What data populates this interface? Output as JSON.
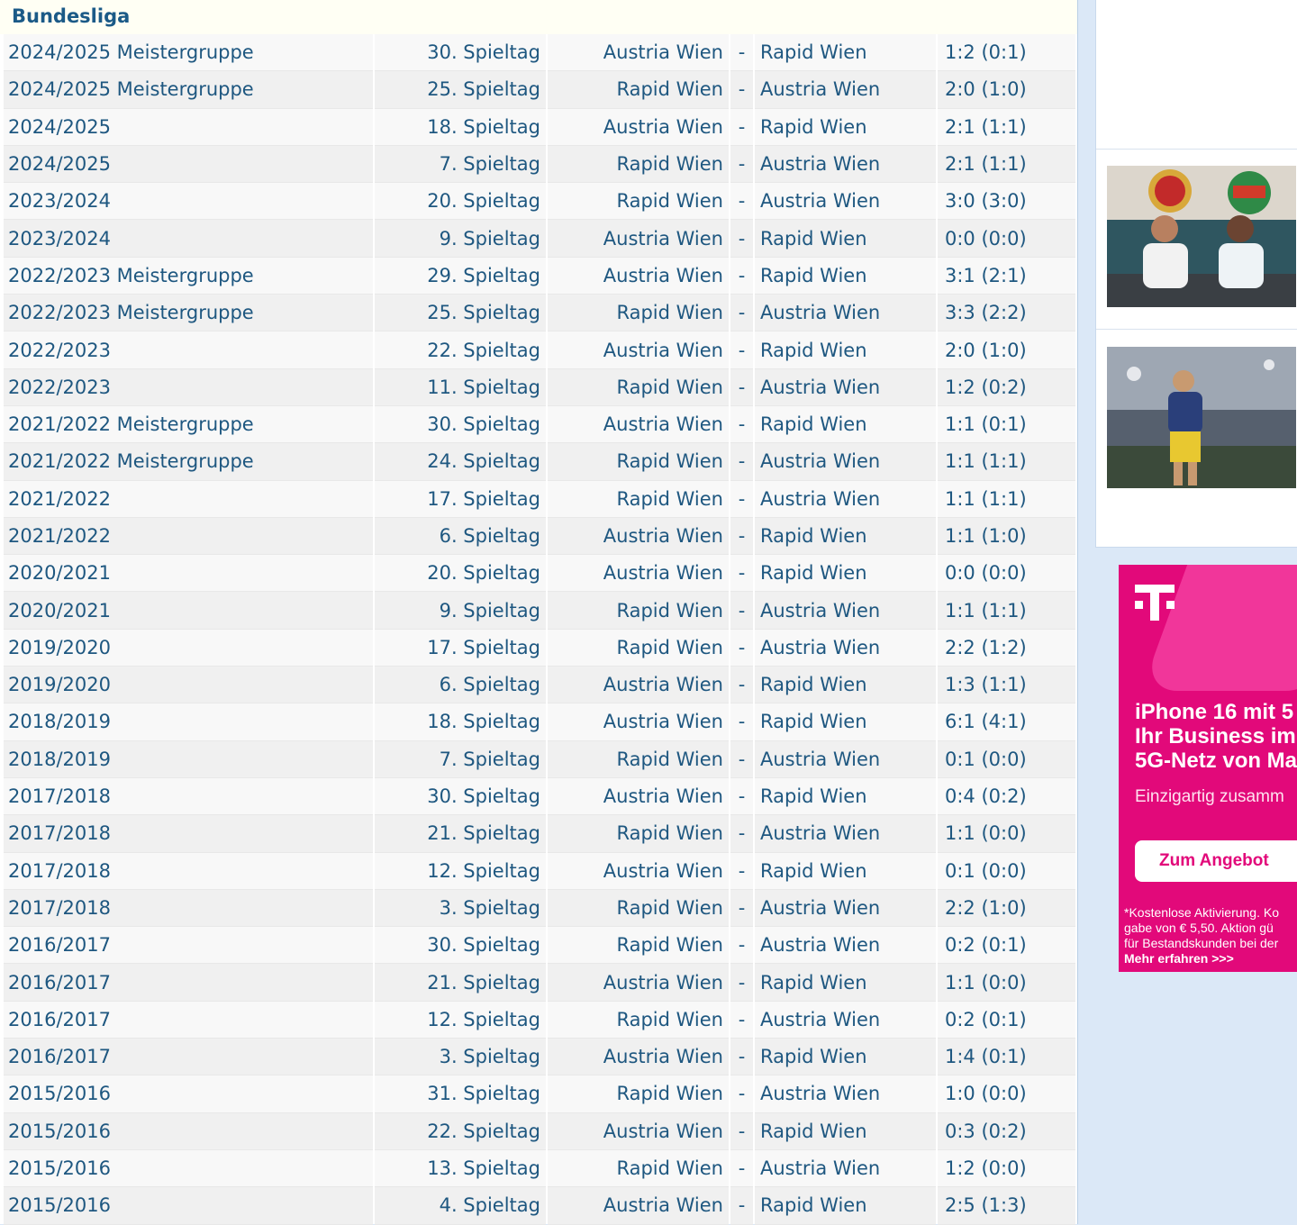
{
  "section": {
    "title": "Bundesliga"
  },
  "matches": [
    {
      "season": "2024/2025 Meistergruppe",
      "round": "30. Spieltag",
      "home": "Austria Wien",
      "sep": "-",
      "away": "Rapid Wien",
      "score": "1:2 (0:1)"
    },
    {
      "season": "2024/2025 Meistergruppe",
      "round": "25. Spieltag",
      "home": "Rapid Wien",
      "sep": "-",
      "away": "Austria Wien",
      "score": "2:0 (1:0)"
    },
    {
      "season": "2024/2025",
      "round": "18. Spieltag",
      "home": "Austria Wien",
      "sep": "-",
      "away": "Rapid Wien",
      "score": "2:1 (1:1)"
    },
    {
      "season": "2024/2025",
      "round": "7. Spieltag",
      "home": "Rapid Wien",
      "sep": "-",
      "away": "Austria Wien",
      "score": "2:1 (1:1)"
    },
    {
      "season": "2023/2024",
      "round": "20. Spieltag",
      "home": "Rapid Wien",
      "sep": "-",
      "away": "Austria Wien",
      "score": "3:0 (3:0)"
    },
    {
      "season": "2023/2024",
      "round": "9. Spieltag",
      "home": "Austria Wien",
      "sep": "-",
      "away": "Rapid Wien",
      "score": "0:0 (0:0)"
    },
    {
      "season": "2022/2023 Meistergruppe",
      "round": "29. Spieltag",
      "home": "Austria Wien",
      "sep": "-",
      "away": "Rapid Wien",
      "score": "3:1 (2:1)"
    },
    {
      "season": "2022/2023 Meistergruppe",
      "round": "25. Spieltag",
      "home": "Rapid Wien",
      "sep": "-",
      "away": "Austria Wien",
      "score": "3:3 (2:2)"
    },
    {
      "season": "2022/2023",
      "round": "22. Spieltag",
      "home": "Austria Wien",
      "sep": "-",
      "away": "Rapid Wien",
      "score": "2:0 (1:0)"
    },
    {
      "season": "2022/2023",
      "round": "11. Spieltag",
      "home": "Rapid Wien",
      "sep": "-",
      "away": "Austria Wien",
      "score": "1:2 (0:2)"
    },
    {
      "season": "2021/2022 Meistergruppe",
      "round": "30. Spieltag",
      "home": "Austria Wien",
      "sep": "-",
      "away": "Rapid Wien",
      "score": "1:1 (0:1)"
    },
    {
      "season": "2021/2022 Meistergruppe",
      "round": "24. Spieltag",
      "home": "Rapid Wien",
      "sep": "-",
      "away": "Austria Wien",
      "score": "1:1 (1:1)"
    },
    {
      "season": "2021/2022",
      "round": "17. Spieltag",
      "home": "Rapid Wien",
      "sep": "-",
      "away": "Austria Wien",
      "score": "1:1 (1:1)"
    },
    {
      "season": "2021/2022",
      "round": "6. Spieltag",
      "home": "Austria Wien",
      "sep": "-",
      "away": "Rapid Wien",
      "score": "1:1 (1:0)"
    },
    {
      "season": "2020/2021",
      "round": "20. Spieltag",
      "home": "Austria Wien",
      "sep": "-",
      "away": "Rapid Wien",
      "score": "0:0 (0:0)"
    },
    {
      "season": "2020/2021",
      "round": "9. Spieltag",
      "home": "Rapid Wien",
      "sep": "-",
      "away": "Austria Wien",
      "score": "1:1 (1:1)"
    },
    {
      "season": "2019/2020",
      "round": "17. Spieltag",
      "home": "Rapid Wien",
      "sep": "-",
      "away": "Austria Wien",
      "score": "2:2 (1:2)"
    },
    {
      "season": "2019/2020",
      "round": "6. Spieltag",
      "home": "Austria Wien",
      "sep": "-",
      "away": "Rapid Wien",
      "score": "1:3 (1:1)"
    },
    {
      "season": "2018/2019",
      "round": "18. Spieltag",
      "home": "Austria Wien",
      "sep": "-",
      "away": "Rapid Wien",
      "score": "6:1 (4:1)"
    },
    {
      "season": "2018/2019",
      "round": "7. Spieltag",
      "home": "Rapid Wien",
      "sep": "-",
      "away": "Austria Wien",
      "score": "0:1 (0:0)"
    },
    {
      "season": "2017/2018",
      "round": "30. Spieltag",
      "home": "Austria Wien",
      "sep": "-",
      "away": "Rapid Wien",
      "score": "0:4 (0:2)"
    },
    {
      "season": "2017/2018",
      "round": "21. Spieltag",
      "home": "Rapid Wien",
      "sep": "-",
      "away": "Austria Wien",
      "score": "1:1 (0:0)"
    },
    {
      "season": "2017/2018",
      "round": "12. Spieltag",
      "home": "Austria Wien",
      "sep": "-",
      "away": "Rapid Wien",
      "score": "0:1 (0:0)"
    },
    {
      "season": "2017/2018",
      "round": "3. Spieltag",
      "home": "Rapid Wien",
      "sep": "-",
      "away": "Austria Wien",
      "score": "2:2 (1:0)"
    },
    {
      "season": "2016/2017",
      "round": "30. Spieltag",
      "home": "Rapid Wien",
      "sep": "-",
      "away": "Austria Wien",
      "score": "0:2 (0:1)"
    },
    {
      "season": "2016/2017",
      "round": "21. Spieltag",
      "home": "Austria Wien",
      "sep": "-",
      "away": "Rapid Wien",
      "score": "1:1 (0:0)"
    },
    {
      "season": "2016/2017",
      "round": "12. Spieltag",
      "home": "Rapid Wien",
      "sep": "-",
      "away": "Austria Wien",
      "score": "0:2 (0:1)"
    },
    {
      "season": "2016/2017",
      "round": "3. Spieltag",
      "home": "Austria Wien",
      "sep": "-",
      "away": "Rapid Wien",
      "score": "1:4 (0:1)"
    },
    {
      "season": "2015/2016",
      "round": "31. Spieltag",
      "home": "Rapid Wien",
      "sep": "-",
      "away": "Austria Wien",
      "score": "1:0 (0:0)"
    },
    {
      "season": "2015/2016",
      "round": "22. Spieltag",
      "home": "Austria Wien",
      "sep": "-",
      "away": "Rapid Wien",
      "score": "0:3 (0:2)"
    },
    {
      "season": "2015/2016",
      "round": "13. Spieltag",
      "home": "Rapid Wien",
      "sep": "-",
      "away": "Austria Wien",
      "score": "1:2 (0:0)"
    },
    {
      "season": "2015/2016",
      "round": "4. Spieltag",
      "home": "Austria Wien",
      "sep": "-",
      "away": "Rapid Wien",
      "score": "2:5 (1:3)"
    }
  ],
  "ad": {
    "headline_1": "iPhone 16 mit 5",
    "headline_2": "Ihr Business im",
    "headline_3": "5G-Netz von Ma",
    "subline": "Einzigartig zusamm",
    "cta": "Zum Angebot",
    "fine_1": "*Kostenlose Aktivierung. Ko",
    "fine_2": "gabe von € 5,50. Aktion gü",
    "fine_3": "für Bestandskunden bei der",
    "more": "Mehr erfahren >>>",
    "brand_color": "#e2097a"
  },
  "colors": {
    "link": "#1e5780",
    "title": "#1b5a87",
    "page_bg": "#dbe8f7"
  }
}
